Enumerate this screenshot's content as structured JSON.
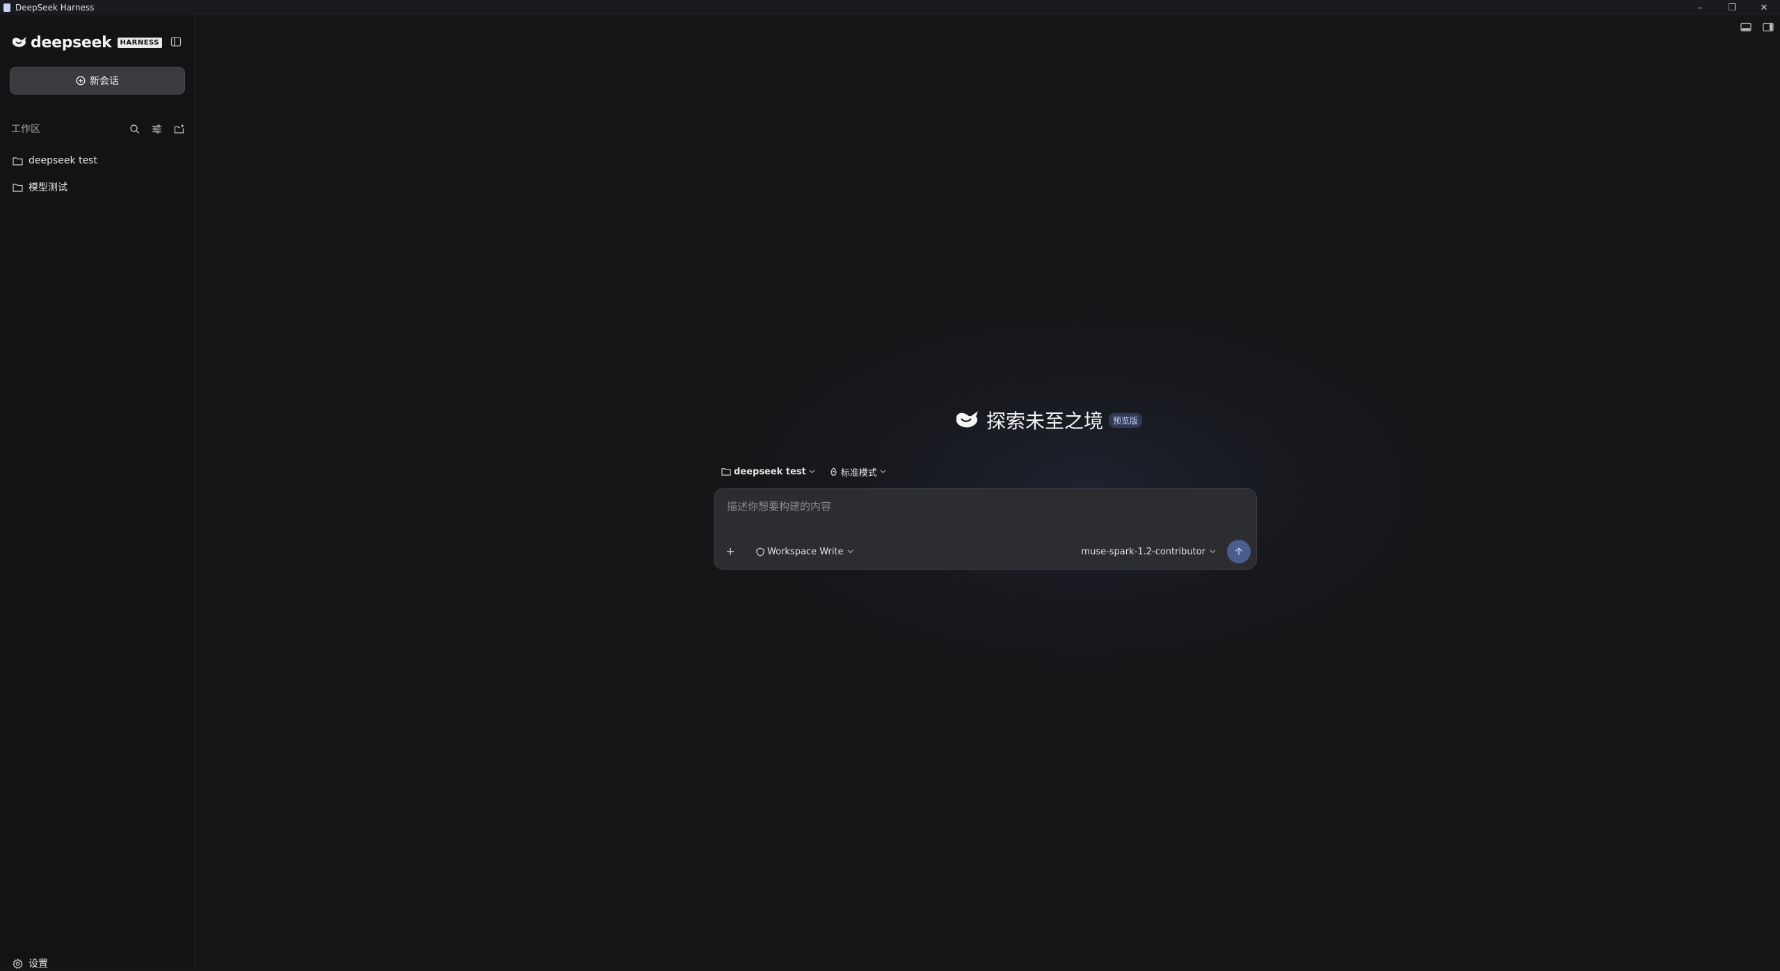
{
  "window": {
    "title": "DeepSeek Harness",
    "minimize": "–",
    "restore": "❐",
    "close": "✕"
  },
  "sidebar": {
    "brand_name": "deepseek",
    "brand_badge": "HARNESS",
    "new_chat_label": "新会话",
    "workspace_label": "工作区",
    "folders": [
      {
        "label": "deepseek test"
      },
      {
        "label": "模型测试"
      }
    ],
    "settings_label": "设置"
  },
  "main": {
    "hero_title": "探索未至之境",
    "preview_badge": "预览版",
    "project_selector": "deepseek test",
    "mode_selector": "标准模式",
    "composer": {
      "placeholder": "描述你想要构建的内容",
      "value": "",
      "permission": "Workspace Write",
      "model": "muse-spark-1.2-contributor"
    }
  },
  "colors": {
    "background": "#151618",
    "sidebar": "#121315",
    "composer": "#2c2d30",
    "send_button": "#4a5d8f",
    "badge": "#2f3a55"
  },
  "icons": [
    "app-icon",
    "whale-icon",
    "sidebar-toggle-icon",
    "plus-circle-icon",
    "search-icon",
    "filter-icon",
    "new-folder-icon",
    "folder-icon",
    "gear-icon",
    "panel-bottom-icon",
    "panel-right-icon",
    "plus-icon",
    "shield-icon",
    "mode-icon",
    "chevron-down-icon",
    "arrow-up-icon"
  ]
}
